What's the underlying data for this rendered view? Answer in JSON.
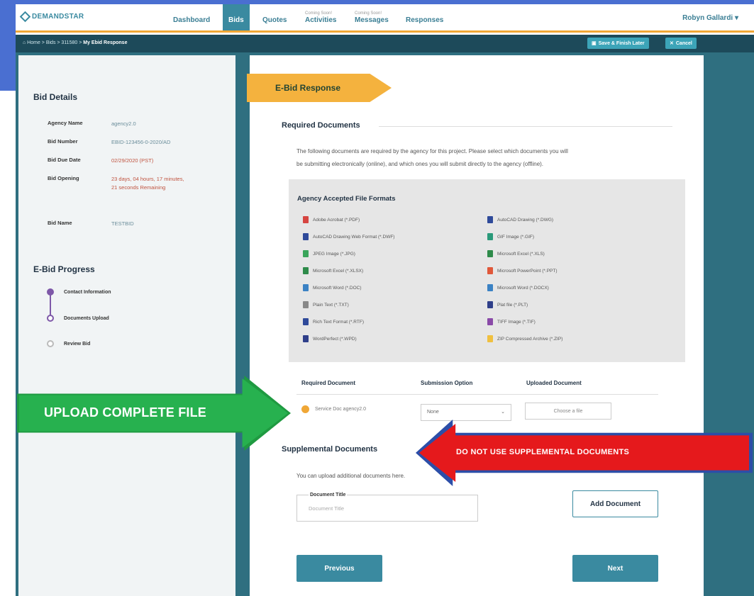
{
  "nav": {
    "logo": "DEMANDSTAR",
    "dashboard": "Dashboard",
    "bids": "Bids",
    "quotes": "Quotes",
    "coming_soon": "Coming Soon!",
    "activities": "Activities",
    "messages": "Messages",
    "responses": "Responses",
    "user": "Robyn Gallardi ▾"
  },
  "breadcrumb": {
    "path": "⌂ Home > Bids > 311580 > ",
    "current": "My Ebid Response",
    "save_label": "Save & Finish Later",
    "cancel_label": "Cancel"
  },
  "bid_details": {
    "title": "Bid Details",
    "rows": [
      {
        "key": "Agency Name",
        "value": "agency2.0"
      },
      {
        "key": "Bid Number",
        "value": "EBID-123456-0-2020/AD"
      },
      {
        "key": "Bid Due Date",
        "value": "02/29/2020 (PST)"
      },
      {
        "key": "Bid Opening",
        "value": "23 days, 04 hours, 17 minutes, 21 seconds Remaining"
      },
      {
        "key": "Bid Name",
        "value": "TESTBID"
      }
    ]
  },
  "progress": {
    "title": "E-Bid Progress",
    "steps": [
      "Contact Information",
      "Documents Upload",
      "Review Bid"
    ]
  },
  "ribbon": "E-Bid Response",
  "required": {
    "title": "Required Documents",
    "description_1": "The following documents are required by the agency for this project. Please select which documents you will",
    "description_2": "be submitting electronically (online), and which ones you will submit directly to the agency (offline).",
    "formats_title": "Agency Accepted File Formats",
    "formats_left": [
      {
        "label": "Adobe Acrobat (*.PDF)",
        "color": "#d64541"
      },
      {
        "label": "AutoCAD Drawing Web Format (*.DWF)",
        "color": "#2f4a9a"
      },
      {
        "label": "JPEG Image (*.JPG)",
        "color": "#3aa55a"
      },
      {
        "label": "Microsoft Excel (*.XLSX)",
        "color": "#2e8b4a"
      },
      {
        "label": "Microsoft Word (*.DOC)",
        "color": "#3b82c4"
      },
      {
        "label": "Plain Text (*.TXT)",
        "color": "#888888"
      },
      {
        "label": "Rich Text Format (*.RTF)",
        "color": "#2f4a9a"
      },
      {
        "label": "WordPerfect (*.WPD)",
        "color": "#2f3f8a"
      }
    ],
    "formats_right": [
      {
        "label": "AutoCAD Drawing (*.DWG)",
        "color": "#2f4a9a"
      },
      {
        "label": "GIF Image (*.GIF)",
        "color": "#2a9a7a"
      },
      {
        "label": "Microsoft Excel (*.XLS)",
        "color": "#2e8b4a"
      },
      {
        "label": "Microsoft PowerPoint (*.PPT)",
        "color": "#e0583a"
      },
      {
        "label": "Microsoft Word (*.DOCX)",
        "color": "#3b82c4"
      },
      {
        "label": "Plat file (*.PLT)",
        "color": "#2f3f8a"
      },
      {
        "label": "TIFF Image (*.TIF)",
        "color": "#8a4aa8"
      },
      {
        "label": "ZIP Compressed Archive (*.ZIP)",
        "color": "#f0c040"
      }
    ],
    "col_required": "Required Document",
    "col_option": "Submission Option",
    "col_uploaded": "Uploaded Document",
    "doc_name": "Service Doc agency2.0",
    "option_value": "None",
    "choose_file": "Choose a file"
  },
  "supplemental": {
    "title": "Supplemental Documents",
    "description": "You can upload additional documents here.",
    "doc_title_label": "Document Title",
    "doc_title_placeholder": "Document Title",
    "add_label": "Add Document"
  },
  "buttons": {
    "previous": "Previous",
    "next": "Next"
  },
  "annotations": {
    "upload": "UPLOAD COMPLETE FILE",
    "warning": "DO NOT USE SUPPLEMENTAL DOCUMENTS",
    "upload_color": "#27b14f",
    "warning_color": "#e5191c"
  }
}
